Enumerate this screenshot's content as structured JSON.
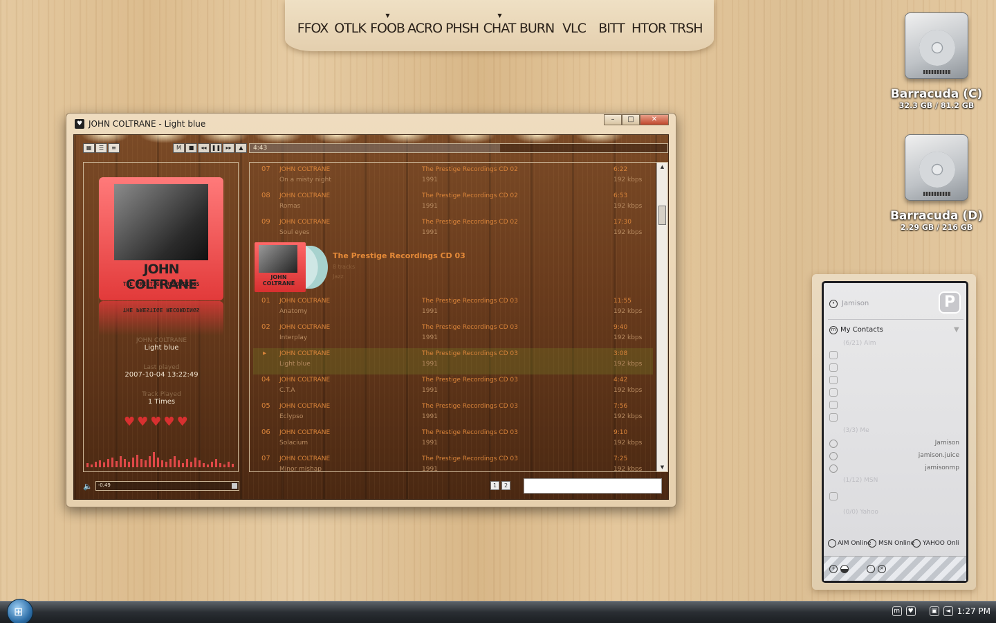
{
  "dock": {
    "items": [
      "FFOX",
      "OTLK",
      "FOOB",
      "ACRO",
      "PHSH",
      "CHAT",
      "BURN",
      "VLC",
      "BITT",
      "HTOR",
      "TRSH"
    ]
  },
  "drives": [
    {
      "name": "Barracuda (C)",
      "size": "32.3 GB / 81.2 GB"
    },
    {
      "name": "Barracuda (D)",
      "size": "2.29 GB / 216 GB"
    }
  ],
  "player": {
    "title": "JOHN COLTRANE - Light blue",
    "elapsed": "4:43",
    "progress": 0.6,
    "volume": "-0.49",
    "cover_main": "JOHN COLTRANE",
    "cover_sub": "THE PRESTIGE RECORDINGS",
    "now": {
      "artist": "JOHN COLTRANE",
      "title": "Light blue",
      "last_played_label": "Last played",
      "last_played": "2007-10-04 13:22:49",
      "track_played_label": "Track Played",
      "track_played": "1 Times"
    },
    "rating": 5,
    "pages": [
      "1",
      "2"
    ],
    "rows_top": [
      {
        "num": "07",
        "artist": "JOHN COLTRANE",
        "title": "On a misty night",
        "album": "The Prestige Recordings  CD 02",
        "year": "1991",
        "dur": "6:22",
        "rate": "192 kbps"
      },
      {
        "num": "08",
        "artist": "JOHN COLTRANE",
        "title": "Romas",
        "album": "The Prestige Recordings  CD 02",
        "year": "1991",
        "dur": "6:53",
        "rate": "192 kbps"
      },
      {
        "num": "09",
        "artist": "JOHN COLTRANE",
        "title": "Soul eyes",
        "album": "The Prestige Recordings  CD 02",
        "year": "1991",
        "dur": "17:30",
        "rate": "192 kbps"
      }
    ],
    "group": {
      "title": "The Prestige Recordings  CD 03",
      "tracks": "8 tracks",
      "genre": "Jazz"
    },
    "rows_bottom": [
      {
        "num": "01",
        "artist": "JOHN COLTRANE",
        "title": "Anatomy",
        "album": "The Prestige Recordings  CD 03",
        "year": "1991",
        "dur": "11:55",
        "rate": "192 kbps"
      },
      {
        "num": "02",
        "artist": "JOHN COLTRANE",
        "title": "Interplay",
        "album": "The Prestige Recordings  CD 03",
        "year": "1991",
        "dur": "9:40",
        "rate": "192 kbps"
      },
      {
        "num": "",
        "artist": "JOHN COLTRANE",
        "title": "Light blue",
        "album": "The Prestige Recordings  CD 03",
        "year": "1991",
        "dur": "3:08",
        "rate": "192 kbps"
      },
      {
        "num": "04",
        "artist": "JOHN COLTRANE",
        "title": "C.T.A",
        "album": "The Prestige Recordings  CD 03",
        "year": "1991",
        "dur": "4:42",
        "rate": "192 kbps"
      },
      {
        "num": "05",
        "artist": "JOHN COLTRANE",
        "title": "Eclypso",
        "album": "The Prestige Recordings  CD 03",
        "year": "1991",
        "dur": "7:56",
        "rate": "192 kbps"
      },
      {
        "num": "06",
        "artist": "JOHN COLTRANE",
        "title": "Solacium",
        "album": "The Prestige Recordings  CD 03",
        "year": "1991",
        "dur": "9:10",
        "rate": "192 kbps"
      },
      {
        "num": "07",
        "artist": "JOHN COLTRANE",
        "title": "Minor mishap",
        "album": "The Prestige Recordings  CD 03",
        "year": "1991",
        "dur": "7:25",
        "rate": "192 kbps"
      }
    ]
  },
  "messenger": {
    "user": "Jamison",
    "logo": "P",
    "my_contacts": "My Contacts",
    "group_aim": "(6/21) Aim",
    "group_me": "(3/3) Me",
    "group_msn": "(1/12) MSN",
    "group_yahoo": "(0/0) Yahoo",
    "me_contacts": [
      "Jamison",
      "jamison.juice",
      "jamisonmp"
    ],
    "aim_status": "AIM Online",
    "msn_status": "MSN Online",
    "yahoo_status": "YAHOO Online"
  },
  "taskbar": {
    "clock": "1:27 PM"
  }
}
